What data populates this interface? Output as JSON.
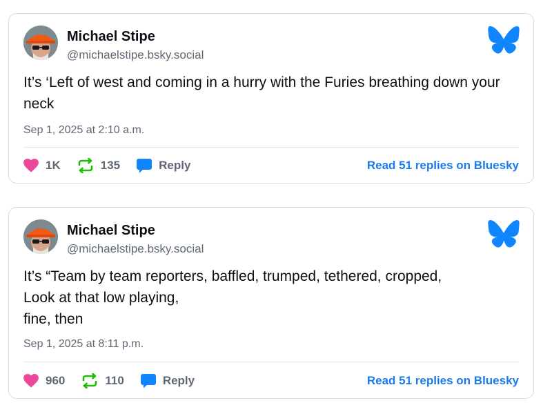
{
  "posts": [
    {
      "author": "Michael Stipe",
      "handle": "@michaelstipe.bsky.social",
      "text": "It’s ‘Left of west and coming in a hurry with the Furies breathing down your neck",
      "timestamp": "Sep 1, 2025 at 2:10 a.m.",
      "likes": "1K",
      "reposts": "135",
      "reply_label": "Reply",
      "read_replies": "Read 51 replies on Bluesky"
    },
    {
      "author": "Michael Stipe",
      "handle": "@michaelstipe.bsky.social",
      "text": "It’s “Team by team reporters, baffled, trumped, tethered, cropped,\nLook at that low playing,\nfine, then",
      "timestamp": "Sep 1, 2025 at 8:11 p.m.",
      "likes": "960",
      "reposts": "110",
      "reply_label": "Reply",
      "read_replies": "Read 51 replies on Bluesky"
    }
  ],
  "icons": {
    "like": "heart-icon",
    "repost": "repost-icon",
    "reply": "speech-bubble-icon",
    "brand": "bluesky-butterfly-icon"
  },
  "colors": {
    "like": "#ec4899",
    "repost": "#20bc07",
    "reply": "#1185fe",
    "brand": "#1185fe",
    "link": "#1a7aea"
  }
}
